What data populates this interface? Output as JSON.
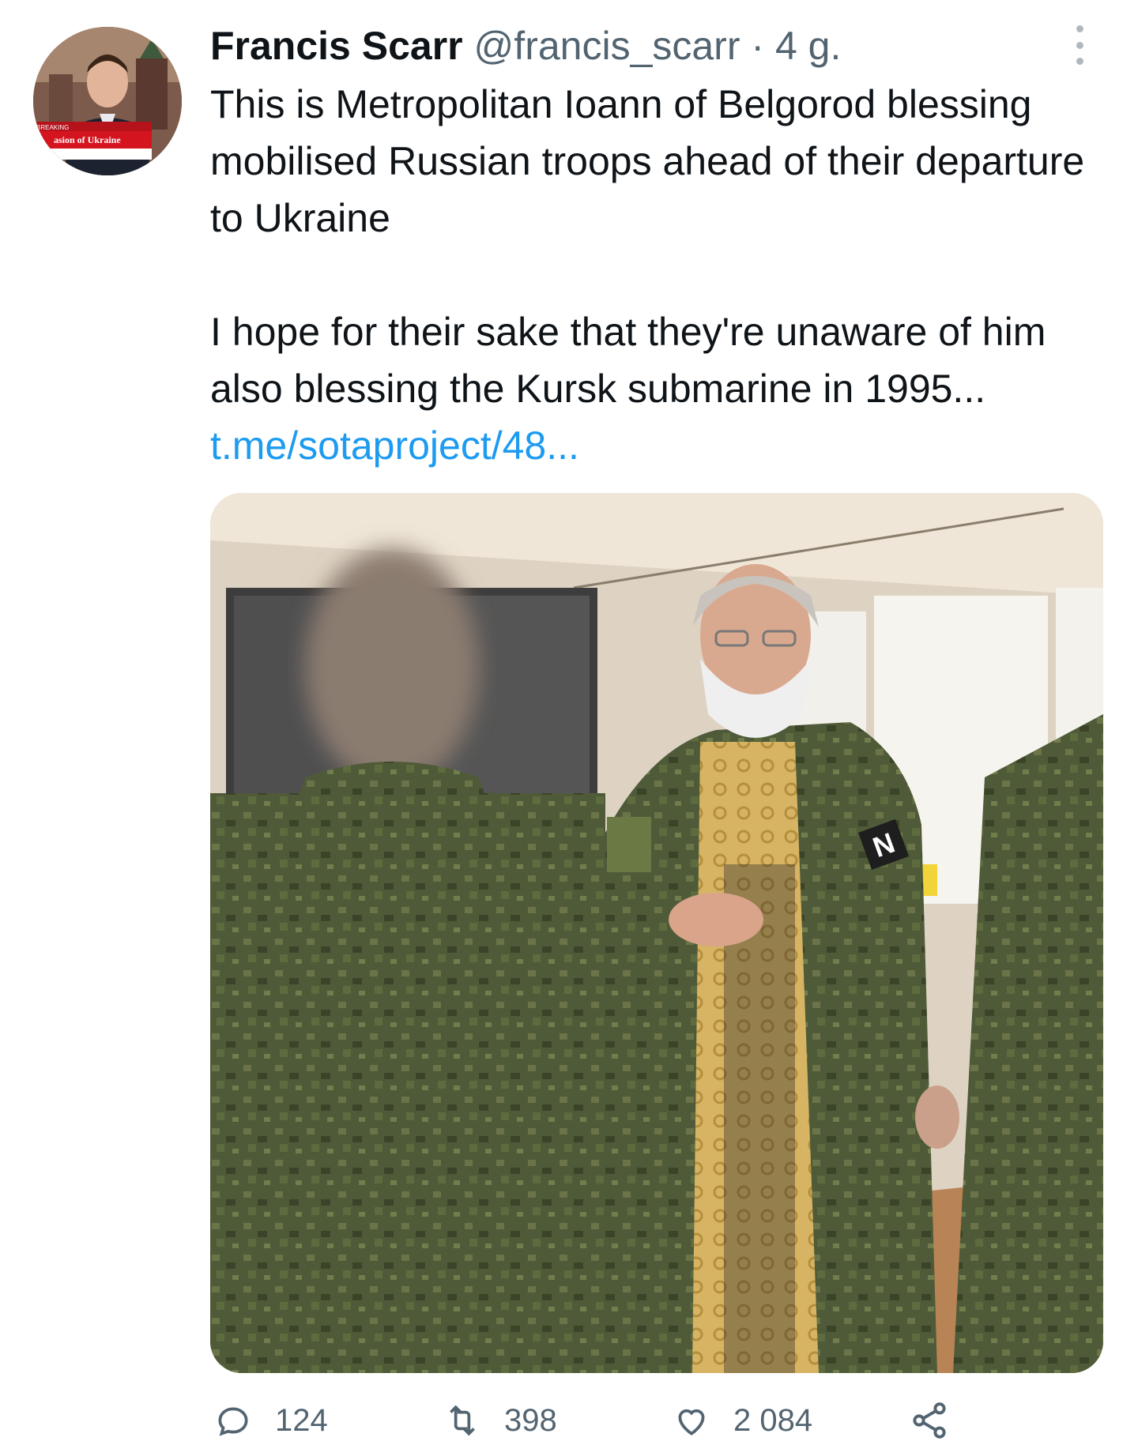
{
  "tweet": {
    "author_name": "Francis Scarr",
    "handle": "@francis_scarr",
    "separator": "·",
    "timestamp": "4 g.",
    "text_paragraph_1": "This is Metropolitan Ioann of Belgorod blessing mobilised  Russian troops ahead of their departure to Ukraine",
    "text_paragraph_2": "I hope for their sake that they're unaware of him also blessing the Kursk submarine in 1995...",
    "link_text": "t.me/sotaproject/48..."
  },
  "avatar": {
    "news_banner_breaking": "BREAKING",
    "news_banner_text": "asion of Ukraine"
  },
  "actions": {
    "reply_count": "124",
    "retweet_count": "398",
    "like_count": "2 084"
  },
  "icons": [
    "more-vertical-icon",
    "reply-icon",
    "retweet-icon",
    "like-icon",
    "share-icon"
  ],
  "colors": {
    "link": "#1d9bf0",
    "muted": "#536471",
    "text": "#0f1419"
  }
}
